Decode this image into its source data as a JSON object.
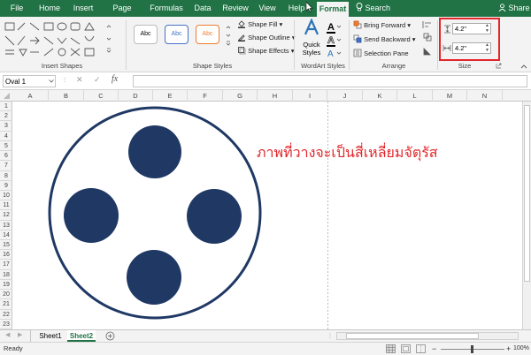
{
  "tabs": [
    "File",
    "Home",
    "Insert",
    "Page Layout",
    "Formulas",
    "Data",
    "Review",
    "View",
    "Help",
    "Format"
  ],
  "active_tab": "Format",
  "search_label": "Search",
  "share_label": "Share",
  "ribbon": {
    "insert_shapes_label": "Insert Shapes",
    "shape_styles_label": "Shape Styles",
    "style_sample": "Abc",
    "shape_fill": "Shape Fill",
    "shape_outline": "Shape Outline",
    "shape_effects": "Shape Effects",
    "quick_styles_line1": "Quick",
    "quick_styles_line2": "Styles",
    "wordart_label": "WordArt Styles",
    "bring_forward": "Bring Forward",
    "send_backward": "Send Backward",
    "selection_pane": "Selection Pane",
    "arrange_label": "Arrange",
    "height_value": "4.2\"",
    "width_value": "4.2\"",
    "size_label": "Size"
  },
  "formula_bar": {
    "name_box": "Oval 1",
    "fx": "fx",
    "cancel": "✕",
    "enter": "✓"
  },
  "columns": [
    "A",
    "B",
    "C",
    "D",
    "E",
    "F",
    "G",
    "H",
    "I",
    "J",
    "K",
    "L",
    "M",
    "N"
  ],
  "rows": [
    "1",
    "2",
    "3",
    "4",
    "5",
    "6",
    "7",
    "8",
    "9",
    "10",
    "11",
    "12",
    "13",
    "14",
    "15",
    "16",
    "17",
    "18",
    "19",
    "20",
    "21",
    "22",
    "23"
  ],
  "annotation_text": "ภาพที่วางจะเป็นสี่เหลี่ยมจัตุรัส",
  "sheets": [
    "Sheet1",
    "Sheet2"
  ],
  "active_sheet": "Sheet2",
  "status": "Ready",
  "zoom": "100%",
  "colors": {
    "excel_green": "#217346",
    "shape_navy": "#1f3864",
    "annotation_red": "#e3262a",
    "highlight_box": "#e3262a"
  }
}
